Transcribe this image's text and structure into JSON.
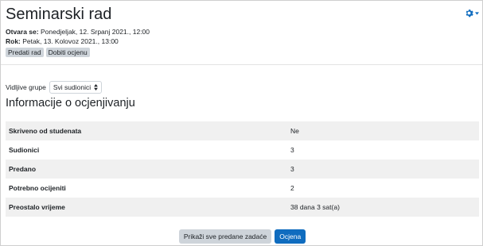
{
  "header": {
    "title": "Seminarski rad",
    "settings_icon": "gear-icon",
    "accent_color": "#0f6cbf"
  },
  "dates": {
    "opens_label": "Otvara se:",
    "opens_value": "Ponedjeljak, 12. Srpanj 2021., 12:00",
    "due_label": "Rok:",
    "due_value": "Petak, 13. Kolovoz 2021., 13:00"
  },
  "status_badges": [
    "Predati rad",
    "Dobiti ocjenu"
  ],
  "groups": {
    "label": "Vidljive grupe",
    "selected": "Svi sudionici"
  },
  "grading_summary": {
    "title": "Informacije o ocjenjivanju",
    "rows": [
      {
        "label": "Skriveno od studenata",
        "value": "Ne"
      },
      {
        "label": "Sudionici",
        "value": "3"
      },
      {
        "label": "Predano",
        "value": "3"
      },
      {
        "label": "Potrebno ocijeniti",
        "value": "2"
      },
      {
        "label": "Preostalo vrijeme",
        "value": "38 dana 3 sat(a)"
      }
    ]
  },
  "actions": {
    "view_all_label": "Prikaži sve predane zadaće",
    "grade_label": "Ocjena"
  }
}
